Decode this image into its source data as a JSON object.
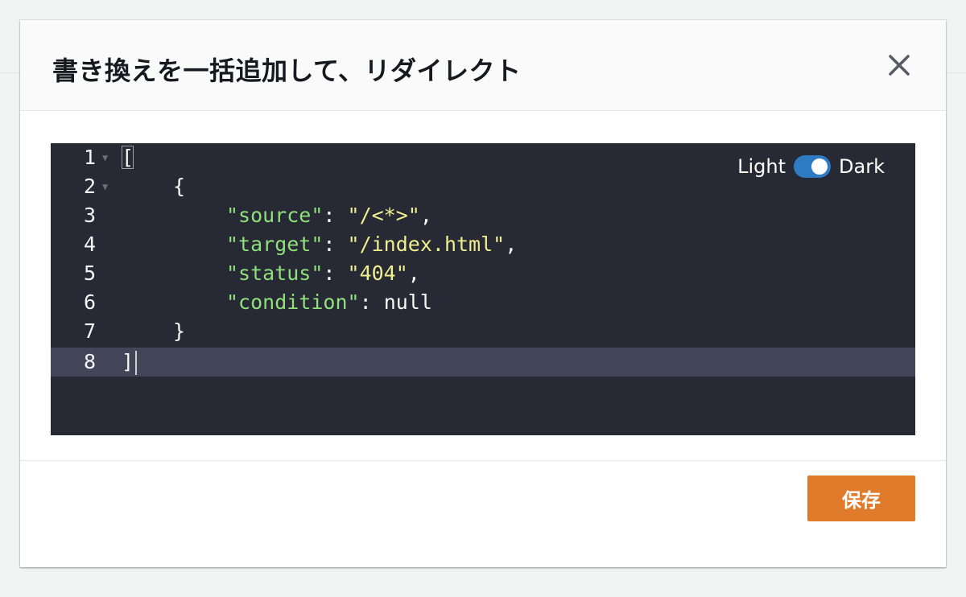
{
  "modal": {
    "title": "書き換えを一括追加して、リダイレクト",
    "close_label": "×"
  },
  "editor": {
    "theme": {
      "light_label": "Light",
      "dark_label": "Dark",
      "selected": "Dark"
    },
    "active_line": 8,
    "lines": [
      {
        "num": "1",
        "foldable": true
      },
      {
        "num": "2",
        "foldable": true
      },
      {
        "num": "3",
        "foldable": false
      },
      {
        "num": "4",
        "foldable": false
      },
      {
        "num": "5",
        "foldable": false
      },
      {
        "num": "6",
        "foldable": false
      },
      {
        "num": "7",
        "foldable": false
      },
      {
        "num": "8",
        "foldable": false
      }
    ],
    "code": {
      "l1_open": "[",
      "l2_open": "{",
      "l3_key": "\"source\"",
      "l3_colon": ": ",
      "l3_val": "\"/<*>\"",
      "l3_comma": ",",
      "l4_key": "\"target\"",
      "l4_colon": ": ",
      "l4_val": "\"/index.html\"",
      "l4_comma": ",",
      "l5_key": "\"status\"",
      "l5_colon": ": ",
      "l5_val": "\"404\"",
      "l5_comma": ",",
      "l6_key": "\"condition\"",
      "l6_colon": ": ",
      "l6_val": "null",
      "l7_close": "}",
      "l8_close": "]"
    }
  },
  "footer": {
    "save_label": "保存"
  },
  "colors": {
    "editor_bg": "#272935",
    "active_line_bg": "#434658",
    "key_color": "#8fe07a",
    "string_color": "#f0ef8e",
    "toggle_color": "#2d7bc3",
    "save_button": "#e07b2b"
  }
}
